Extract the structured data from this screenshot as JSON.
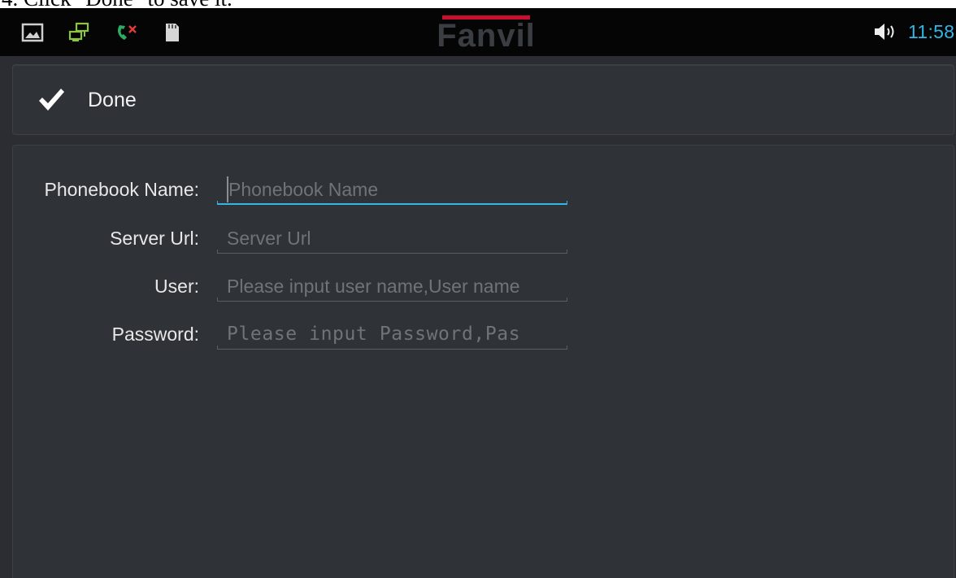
{
  "caption": "4. Click \"Done\" to save it.",
  "status_bar": {
    "icons": [
      "gallery-icon",
      "network-icon",
      "missed-call-icon",
      "sd-card-icon"
    ],
    "brand": "Fanvil",
    "time": "11:58",
    "accent_color": "#33b5e5"
  },
  "action_bar": {
    "done_label": "Done",
    "icon": "checkmark-icon"
  },
  "form": {
    "fields": [
      {
        "label": "Phonebook Name:",
        "placeholder": "Phonebook Name",
        "active": true
      },
      {
        "label": "Server Url:",
        "placeholder": "Server Url",
        "active": false
      },
      {
        "label": "User:",
        "placeholder": "Please input user name,User name",
        "active": false
      },
      {
        "label": "Password:",
        "placeholder": "Please input Password,Pas",
        "active": false
      }
    ]
  }
}
